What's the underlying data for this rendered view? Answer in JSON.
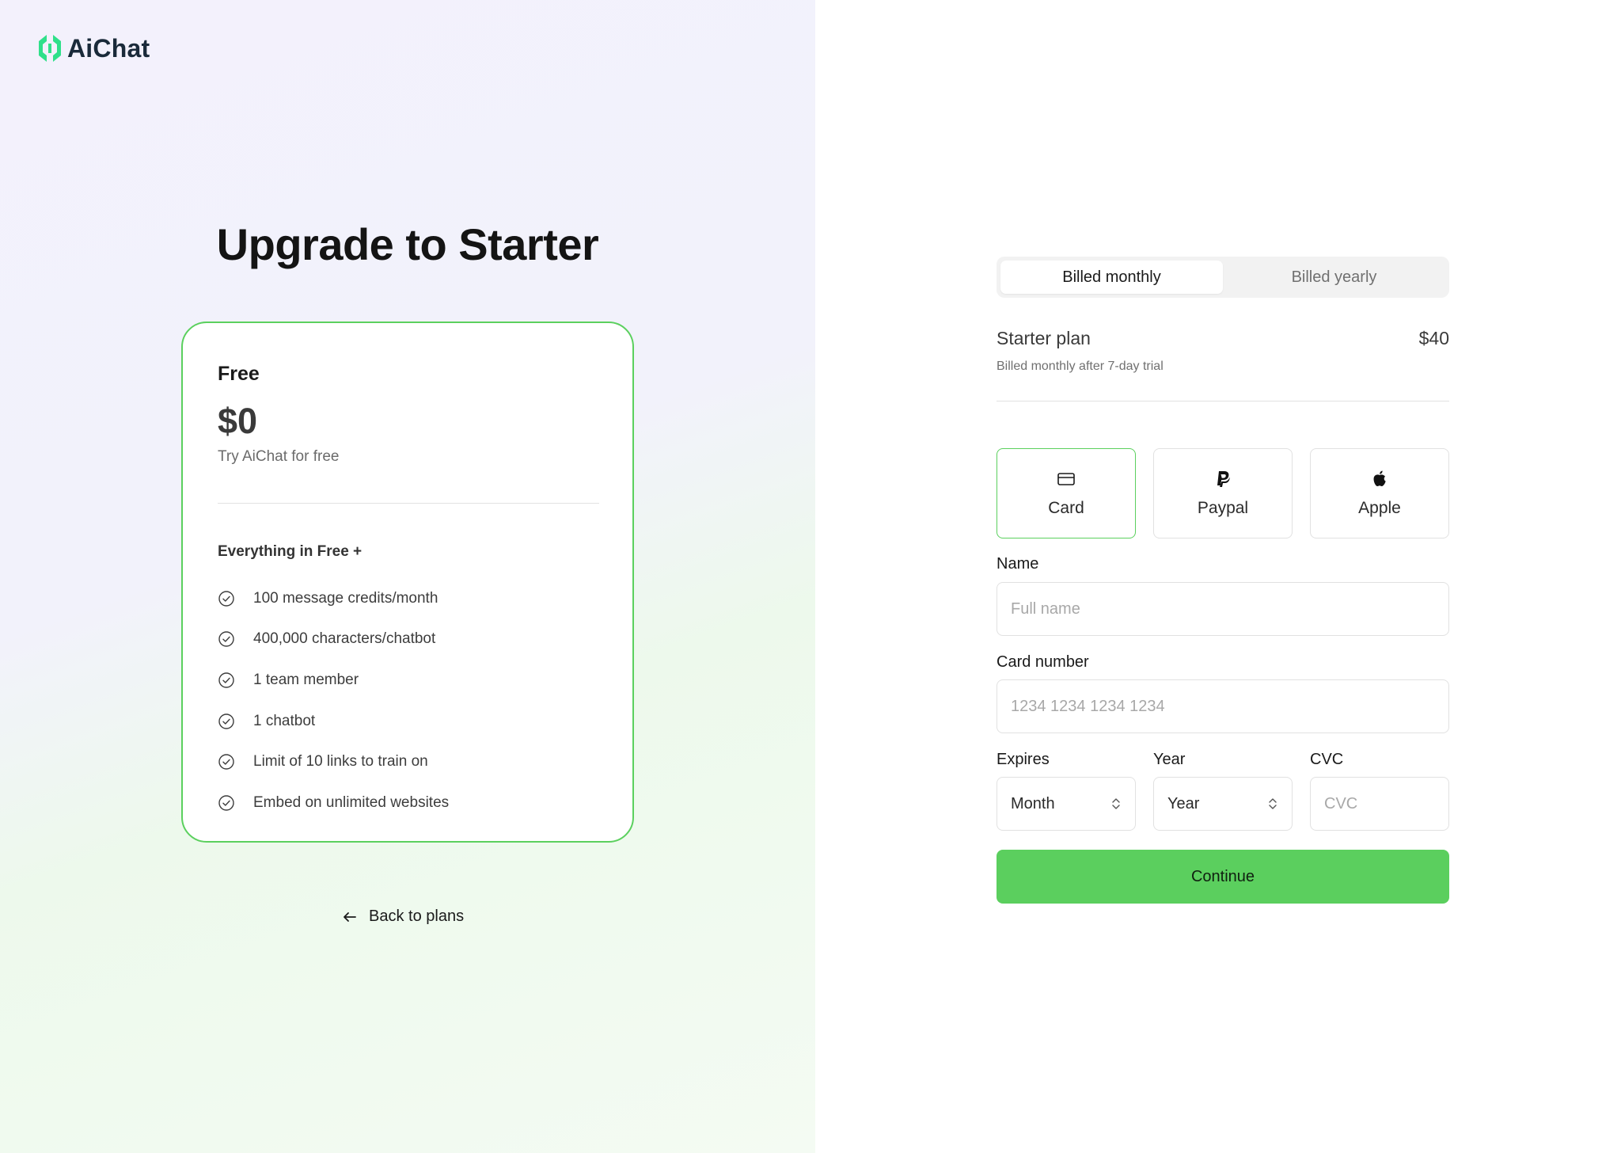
{
  "brand": {
    "name": "AiChat",
    "accent": "#5bcf5e",
    "logo_color": "#2fe08a"
  },
  "headline": "Upgrade to Starter",
  "plan_card": {
    "name": "Free",
    "price": "$0",
    "description": "Try AiChat for free",
    "features_title": "Everything in Free +",
    "features": [
      "100 message credits/month",
      "400,000 characters/chatbot",
      "1 team member",
      "1 chatbot",
      "Limit of 10 links to train on",
      "Embed on unlimited websites"
    ]
  },
  "back_link": {
    "label": "Back to plans",
    "icon": "arrow-left-icon"
  },
  "billing_toggle": {
    "monthly": "Billed monthly",
    "yearly": "Billed yearly",
    "selected": "monthly"
  },
  "summary": {
    "plan": "Starter plan",
    "price": "$40",
    "note": "Billed monthly after 7-day trial"
  },
  "payment_methods": [
    {
      "label": "Card",
      "icon": "credit-card-icon",
      "selected": true
    },
    {
      "label": "Paypal",
      "icon": "paypal-icon",
      "selected": false
    },
    {
      "label": "Apple",
      "icon": "apple-icon",
      "selected": false
    }
  ],
  "form": {
    "name_label": "Name",
    "name_placeholder": "Full name",
    "card_label": "Card number",
    "card_placeholder": "1234 1234 1234 1234",
    "expires_label": "Expires",
    "month_value": "Month",
    "year_label": "Year",
    "year_value": "Year",
    "cvc_label": "CVC",
    "cvc_placeholder": "CVC"
  },
  "continue_label": "Continue"
}
